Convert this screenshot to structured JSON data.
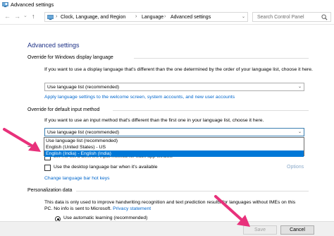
{
  "window": {
    "title": "Advanced settings"
  },
  "nav": {
    "back": "←",
    "forward": "→",
    "dropdown": "⌄",
    "up": "↑"
  },
  "breadcrumb": {
    "items": [
      "Clock, Language, and Region",
      "Language",
      "Advanced settings"
    ],
    "separator": "›",
    "dropdown": "⌄"
  },
  "search": {
    "placeholder": "Search Control Panel"
  },
  "page": {
    "heading": "Advanced settings",
    "display_language": {
      "label": "Override for Windows display language",
      "description": "If you want to use a display language that's different than the one determined by the order of your language list, choose it here.",
      "selected": "Use language list (recommended)",
      "link": "Apply language settings to the welcome screen, system accounts, and new user accounts"
    },
    "input_method": {
      "label": "Override for default input method",
      "description": "If you want to use an input method that's different than the first one in your language list, choose it here.",
      "selected": "Use language list (recommended)",
      "options": [
        "Use language list (recommended)",
        "English (United States) - US",
        "English (India) - English (India)"
      ],
      "highlighted_option": "English (India) - English (India)"
    },
    "switching": {
      "label_partial": "S",
      "per_app_checkbox_partial": "Let me set a different input method for each app window",
      "desktop_bar_checkbox": "Use the desktop language bar when it's available",
      "options_link": "Options",
      "hotkeys_link": "Change language bar hot keys"
    },
    "personalization": {
      "label": "Personalization data",
      "description_line1": "This data is only used to improve handwriting recognition and text prediction results for languages without IMEs on this",
      "description_line2": "PC. No info is sent to Microsoft.",
      "privacy_link": "Privacy statement",
      "radio_label": "Use automatic learning (recommended)"
    }
  },
  "footer": {
    "save": "Save",
    "cancel": "Cancel"
  },
  "colors": {
    "heading": "#1e3287",
    "link": "#0066cc",
    "selection": "#0078d7",
    "arrow": "#e8317b"
  }
}
